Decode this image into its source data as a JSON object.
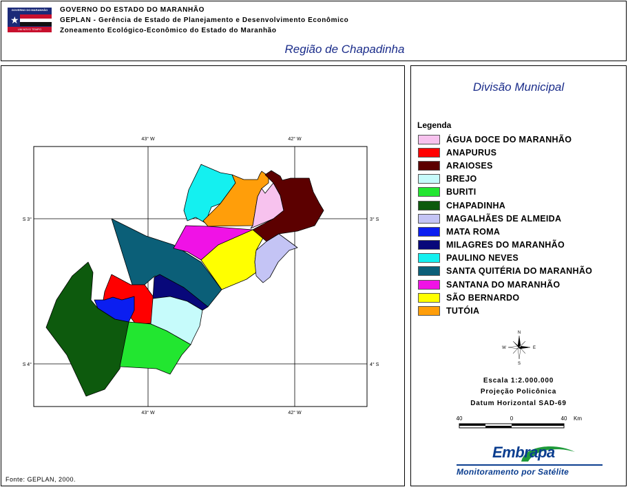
{
  "header": {
    "line1": "GOVERNO DO ESTADO DO MARANHÃO",
    "line2": "GEPLAN - Gerência de Estado de Planejamento e Desenvolvimento Econômico",
    "line3": "Zoneamento Ecológico-Econômico do Estado do Maranhão",
    "region_title": "Região de Chapadinha",
    "logo_top": "GOVERNO DO MARANHÃO",
    "logo_bottom": "UM NOVO TEMPO"
  },
  "map": {
    "ticks": {
      "top_left_lon": "43° W",
      "top_right_lon": "42° W",
      "bottom_left_lon": "43° W",
      "bottom_right_lon": "42° W",
      "left_upper_lat": "S 3°",
      "left_lower_lat": "S 4°",
      "right_upper_lat": "3° S",
      "right_lower_lat": "4° S"
    },
    "source": "Fonte: GEPLAN, 2000."
  },
  "legend": {
    "title": "Divisão Municipal",
    "heading": "Legenda",
    "items": [
      {
        "label": "ÁGUA DOCE DO MARANHÃO",
        "color": "#f7c2ee"
      },
      {
        "label": "ANAPURUS",
        "color": "#ff0000"
      },
      {
        "label": "ARAIOSES",
        "color": "#5c0000"
      },
      {
        "label": "BREJO",
        "color": "#c6fbfb"
      },
      {
        "label": "BURITI",
        "color": "#22e630"
      },
      {
        "label": "CHAPADINHA",
        "color": "#0d5a0d"
      },
      {
        "label": "MAGALHÃES DE ALMEIDA",
        "color": "#c4c4f5"
      },
      {
        "label": "MATA ROMA",
        "color": "#0b1ef0"
      },
      {
        "label": "MILAGRES DO MARANHÃO",
        "color": "#08087a"
      },
      {
        "label": "PAULINO NEVES",
        "color": "#14f0f0"
      },
      {
        "label": "SANTA QUITÉRIA DO MARANHÃO",
        "color": "#0b5f78"
      },
      {
        "label": "SANTANA DO MARANHÃO",
        "color": "#f012e6"
      },
      {
        "label": "SÃO BERNARDO",
        "color": "#ffff00"
      },
      {
        "label": "TUTÓIA",
        "color": "#ff9e0a"
      }
    ],
    "compass": {
      "n": "N",
      "s": "S",
      "e": "E",
      "w": "W"
    },
    "scale": "Escala 1:2.000.000",
    "projection": "Projeção Policônica",
    "datum": "Datum Horizontal  SAD-69",
    "scalebar": {
      "left": "40",
      "mid": "0",
      "right": "40",
      "unit": "Km"
    },
    "embrapa": {
      "name": "Embrapa",
      "subtitle": "Monitoramento por Satélite"
    }
  }
}
